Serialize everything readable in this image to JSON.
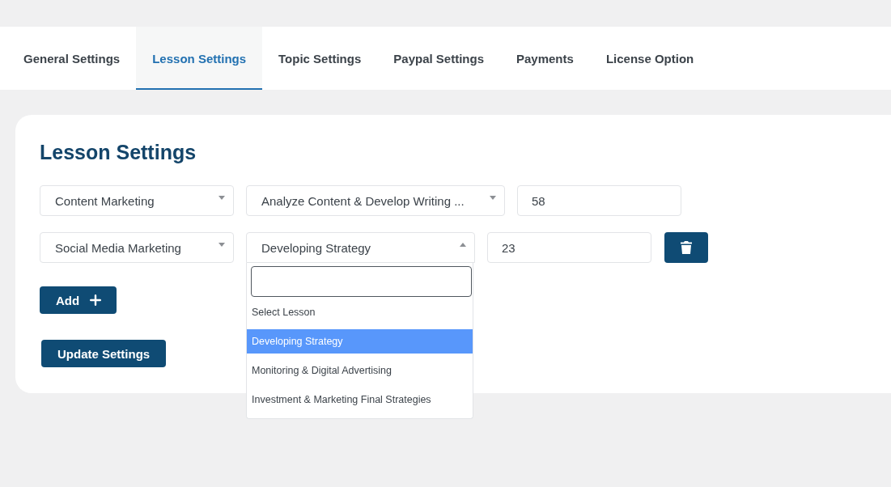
{
  "tabs": [
    {
      "label": "General Settings",
      "selected": false
    },
    {
      "label": "Lesson Settings",
      "selected": true
    },
    {
      "label": "Topic Settings",
      "selected": false
    },
    {
      "label": "Paypal Settings",
      "selected": false
    },
    {
      "label": "Payments",
      "selected": false
    },
    {
      "label": "License Option",
      "selected": false
    }
  ],
  "panel": {
    "title": "Lesson Settings",
    "rows": [
      {
        "first_select": {
          "value": "Content Marketing",
          "expanded": false
        },
        "second_select": {
          "value": "Analyze Content & Develop Writing ...",
          "expanded": false
        },
        "number": "58",
        "removable": false
      },
      {
        "first_select": {
          "value": "Social Media Marketing",
          "expanded": false
        },
        "second_select": {
          "value": "Developing Strategy",
          "expanded": true,
          "options": [
            {
              "label": "Select Lesson",
              "selected": false
            },
            {
              "label": "Developing Strategy",
              "selected": true
            },
            {
              "label": "Monitoring & Digital Advertising",
              "selected": false
            },
            {
              "label": "Investment & Marketing Final Strategies",
              "selected": false
            }
          ]
        },
        "number": "23",
        "removable": true
      }
    ],
    "add_button": "Add",
    "submit_button": "Update Settings"
  }
}
